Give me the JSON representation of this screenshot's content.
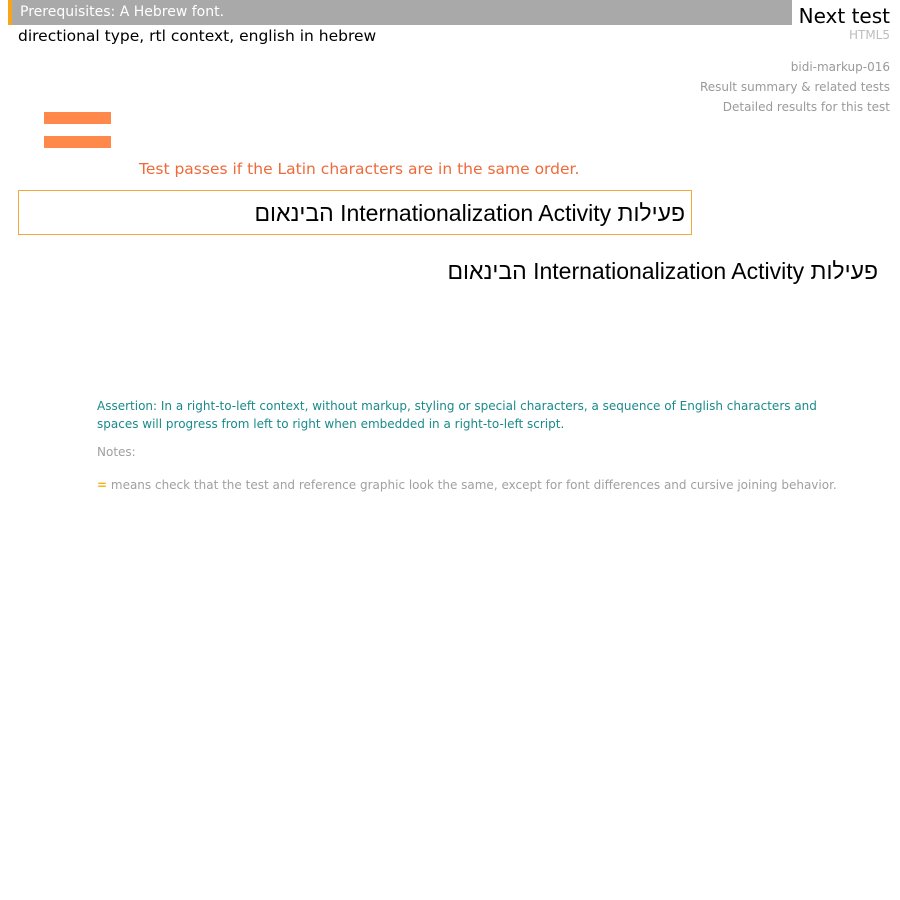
{
  "header": {
    "prerequisites": "Prerequisites: A Hebrew font.",
    "title": "directional type, rtl context, english in hebrew",
    "next_test": "Next test",
    "spec": "HTML5",
    "test_id": "bidi-markup-016",
    "summary_link": "Result summary & related tests",
    "detail_link": "Detailed results for this test"
  },
  "instructions": "Test passes if the Latin characters are in the same order.",
  "test_text": "פעילות Internationalization Activity הבינאום",
  "reference_text": "פעילות Internationalization Activity הבינאום",
  "assertion": "Assertion: In a right-to-left context, without markup, styling or special characters, a sequence of English characters and spaces will progress from left to right when embedded in a right-to-left script.",
  "notes": {
    "label": "Notes:",
    "symbol": "=",
    "text": " means check that the test and reference graphic look the same, except for font differences and cursive joining behavior."
  },
  "colors": {
    "prereq_bar": "#a9a9a9",
    "prereq_accent": "#f7a51b",
    "equals_icon": "#ff884b",
    "instructions": "#ef6a3a",
    "test_box_border": "#f0a93a",
    "assertion": "#1a8a8a",
    "notes": "#a0a0a0"
  },
  "icons": {
    "equals": "equals-icon"
  }
}
